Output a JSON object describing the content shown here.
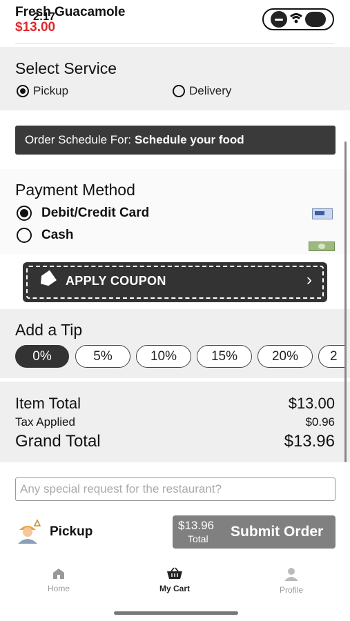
{
  "header": {
    "item_name": "Fresh Guacamole",
    "item_price": "$13.00",
    "time": "2:17"
  },
  "service": {
    "title": "Select Service",
    "options": [
      "Pickup",
      "Delivery"
    ],
    "selected": "Pickup"
  },
  "schedule": {
    "prefix": "Order Schedule For:",
    "value": "Schedule your food"
  },
  "payment": {
    "title": "Payment Method",
    "options": [
      "Debit/Credit Card",
      "Cash"
    ],
    "selected": "Debit/Credit Card",
    "icons": [
      "credit-card-icon",
      "cash-icon"
    ]
  },
  "coupon": {
    "label": "APPLY COUPON"
  },
  "tip": {
    "title": "Add a Tip",
    "options": [
      "0%",
      "5%",
      "10%",
      "15%",
      "20%",
      "2"
    ],
    "selected": "0%"
  },
  "summary": {
    "item_total_label": "Item Total",
    "item_total": "$13.00",
    "tax_label": "Tax Applied",
    "tax": "$0.96",
    "grand_total_label": "Grand Total",
    "grand_total": "$13.96"
  },
  "request": {
    "placeholder": "Any special request for the restaurant?"
  },
  "footer": {
    "mode_label": "Pickup",
    "submit_price": "$13.96",
    "submit_total_label": "Total",
    "submit_label": "Submit Order"
  },
  "nav": {
    "items": [
      "Home",
      "My Cart",
      "Profile"
    ],
    "active": "My Cart"
  },
  "colors": {
    "accent_red": "#e0242b",
    "dark": "#333333",
    "submit_gray": "#808080"
  }
}
